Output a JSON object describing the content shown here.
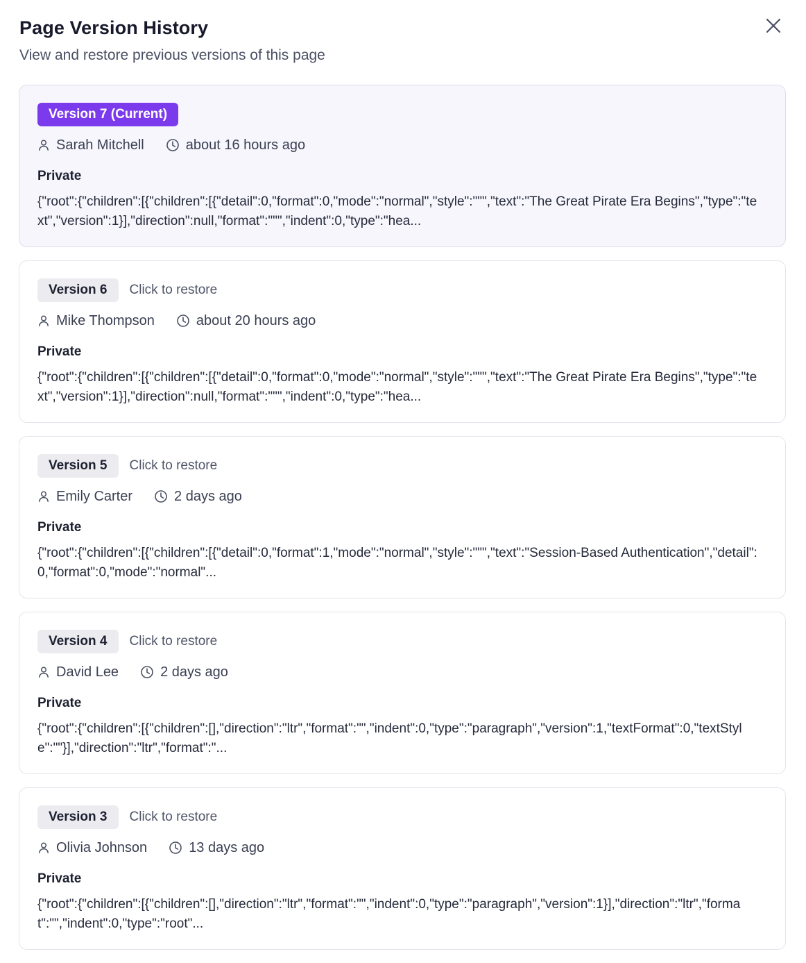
{
  "header": {
    "title": "Page Version History",
    "subtitle": "View and restore previous versions of this page",
    "close_icon": "close-icon"
  },
  "versions": [
    {
      "label": "Version 7 (Current)",
      "current": true,
      "restore_hint": "",
      "author": "Sarah Mitchell",
      "time": "about 16 hours ago",
      "visibility": "Private",
      "preview": "{\"root\":{\"children\":[{\"children\":[{\"detail\":0,\"format\":0,\"mode\":\"normal\",\"style\":\"\"\",\"text\":\"The Great Pirate Era Begins\",\"type\":\"text\",\"version\":1}],\"direction\":null,\"format\":\"\"\",\"indent\":0,\"type\":\"hea..."
    },
    {
      "label": "Version 6",
      "current": false,
      "restore_hint": "Click to restore",
      "author": "Mike Thompson",
      "time": "about 20 hours ago",
      "visibility": "Private",
      "preview": "{\"root\":{\"children\":[{\"children\":[{\"detail\":0,\"format\":0,\"mode\":\"normal\",\"style\":\"\"\",\"text\":\"The Great Pirate Era Begins\",\"type\":\"text\",\"version\":1}],\"direction\":null,\"format\":\"\"\",\"indent\":0,\"type\":\"hea..."
    },
    {
      "label": "Version 5",
      "current": false,
      "restore_hint": "Click to restore",
      "author": "Emily Carter",
      "time": "2 days ago",
      "visibility": "Private",
      "preview": "{\"root\":{\"children\":[{\"children\":[{\"detail\":0,\"format\":1,\"mode\":\"normal\",\"style\":\"\"\",\"text\":\"Session-Based Authentication\",\"detail\":0,\"format\":0,\"mode\":\"normal\"..."
    },
    {
      "label": "Version 4",
      "current": false,
      "restore_hint": "Click to restore",
      "author": "David Lee",
      "time": "2 days ago",
      "visibility": "Private",
      "preview": "{\"root\":{\"children\":[{\"children\":[],\"direction\":\"ltr\",\"format\":\"\",\"indent\":0,\"type\":\"paragraph\",\"version\":1,\"textFormat\":0,\"textStyle\":\"\"}],\"direction\":\"ltr\",\"format\":\"..."
    },
    {
      "label": "Version 3",
      "current": false,
      "restore_hint": "Click to restore",
      "author": "Olivia Johnson",
      "time": "13 days ago",
      "visibility": "Private",
      "preview": "{\"root\":{\"children\":[{\"children\":[],\"direction\":\"ltr\",\"format\":\"\",\"indent\":0,\"type\":\"paragraph\",\"version\":1}],\"direction\":\"ltr\",\"format\":\"\",\"indent\":0,\"type\":\"root\"..."
    }
  ],
  "icons": {
    "author": "user-icon",
    "time": "clock-icon"
  },
  "colors": {
    "accent": "#7c3aed",
    "current_card_bg": "#f6f6fc",
    "badge_bg": "#ebebf0"
  }
}
